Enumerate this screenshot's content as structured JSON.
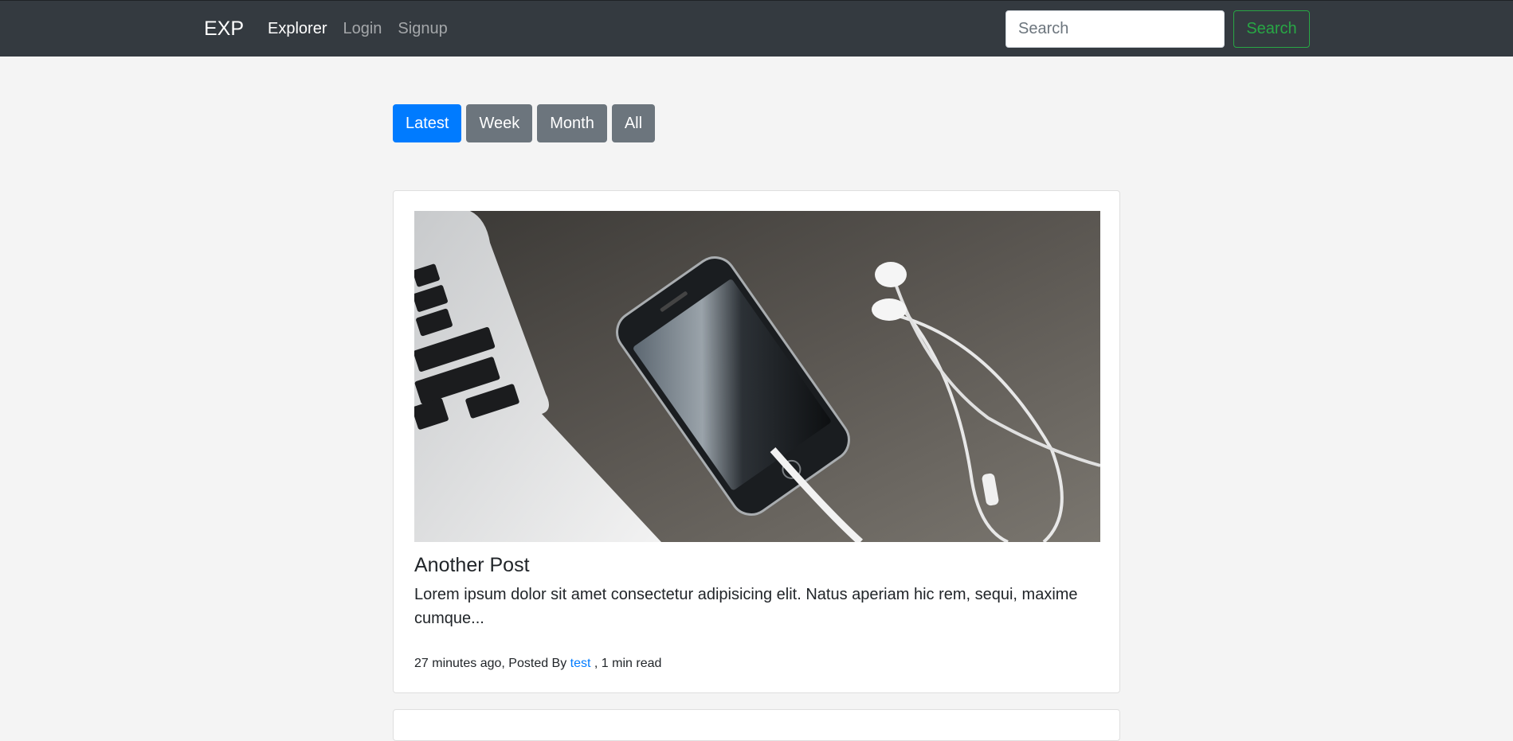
{
  "navbar": {
    "brand": "EXP",
    "links": [
      {
        "label": "Explorer",
        "active": true
      },
      {
        "label": "Login",
        "active": false
      },
      {
        "label": "Signup",
        "active": false
      }
    ],
    "search_placeholder": "Search",
    "search_button": "Search"
  },
  "filters": [
    {
      "label": "Latest",
      "active": true
    },
    {
      "label": "Week",
      "active": false
    },
    {
      "label": "Month",
      "active": false
    },
    {
      "label": "All",
      "active": false
    }
  ],
  "post": {
    "image_subject": "laptop-phone-earbuds-photo",
    "title": "Another Post",
    "excerpt": "Lorem ipsum dolor sit amet consectetur adipisicing elit. Natus aperiam hic rem, sequi, maxime cumque...",
    "meta": {
      "time": "27 minutes ago, Posted By",
      "author": "test",
      "read_time": ", 1 min read"
    }
  },
  "colors": {
    "navbar_bg": "#343a40",
    "primary": "#007bff",
    "secondary": "#6c757d",
    "success": "#28a745",
    "page_bg": "#f4f4f4"
  }
}
